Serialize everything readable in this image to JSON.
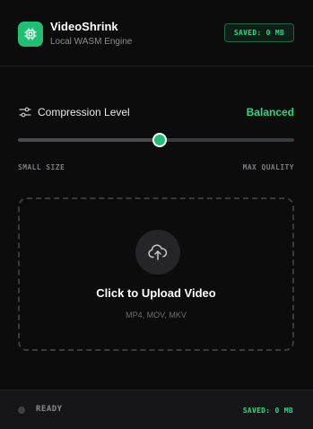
{
  "app": {
    "title": "VideoShrink",
    "subtitle": "Local WASM Engine",
    "saved_badge": "SAVED: 0 MB",
    "logo_icon": "cpu-chip-icon"
  },
  "compression": {
    "icon": "sliders-icon",
    "label": "Compression Level",
    "value_label": "Balanced",
    "level_percent": 50,
    "min_label": "SMALL SIZE",
    "max_label": "MAX QUALITY"
  },
  "upload": {
    "icon": "cloud-upload-icon",
    "title": "Click to Upload Video",
    "formats": "MP4, MOV, MKV"
  },
  "footer": {
    "status": "READY",
    "saved": "SAVED: 0 MB"
  },
  "colors": {
    "accent": "#1fbf74",
    "accent_text": "#2bd884",
    "background": "#0c0c0d"
  }
}
